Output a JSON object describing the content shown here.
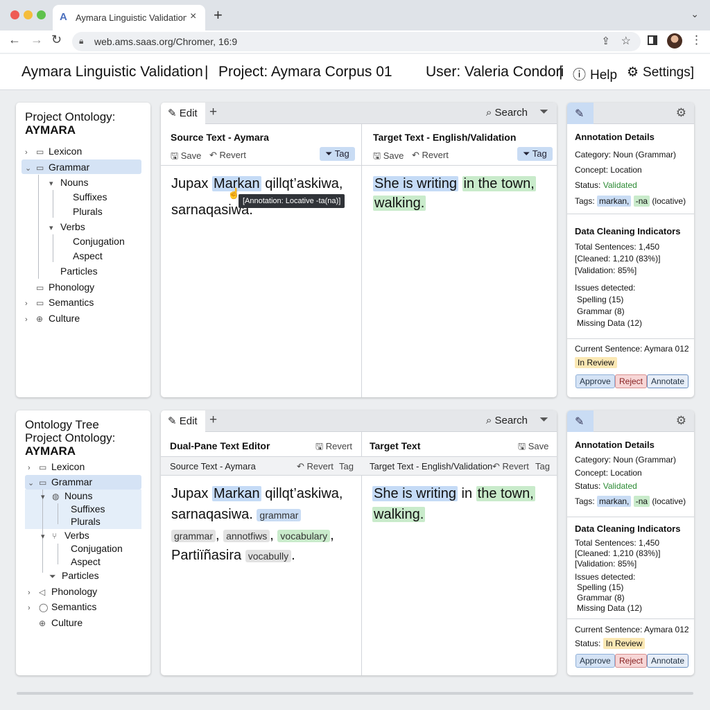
{
  "browser": {
    "tab_title": "Aymara Linguistic Validation",
    "url": "web.ams.saas.org/Chromer, 16:9"
  },
  "header": {
    "app_title": "Aymara Linguistic Validation",
    "separator": "|",
    "project": "Project: Aymara Corpus 01",
    "user": "User: Valeria Condori",
    "help": "Help",
    "settings": "Settings]"
  },
  "tree1": {
    "title_line1": "Project Ontology:",
    "title_line2": "AYMARA",
    "items": [
      "Lexicon",
      "Grammar",
      "Nouns",
      "Suffixes",
      "Plurals",
      "Verbs",
      "Conjugation",
      "Aspect",
      "Particles",
      "Phonology",
      "Semantics",
      "Culture"
    ]
  },
  "editor1": {
    "tab": "Edit",
    "search": "Search",
    "source_title": "Source Text - Aymara",
    "target_title": "Target Text - English/Validation",
    "save": "Save",
    "revert": "Revert",
    "tag": "Tag",
    "src_w1": "Jupax",
    "src_hl": "Markan",
    "src_w2": "qillqt’askiwa,",
    "src_line2": "sarnaqasiwa.",
    "tooltip": "[Annotation: Locative -ta(na)]",
    "tgt_hl1": "She is writing",
    "tgt_hl2": "in the town,",
    "tgt_line2": "walking."
  },
  "side1": {
    "heading": "Annotation Details",
    "category": "Category: Noun (Grammar)",
    "concept": "Concept: Location",
    "status_label": "Status:",
    "status_value": "Validated",
    "tags_label": "Tags:",
    "tag1": "markan,",
    "tag2": "-na",
    "tag_note": "(locative)",
    "dc_heading": "Data Cleaning Indicators",
    "total": "Total Sentences: 1,450",
    "cleaned": "[Cleaned: 1,210 (83%)]",
    "validation": "[Validation: 85%]",
    "issues": "Issues detected:",
    "spelling": "Spelling (15)",
    "grammar": "Grammar (8)",
    "missing": "Missing Data (12)",
    "current": "Current Sentence: Aymara 012",
    "status_badge": "In Review",
    "approve": "Approve",
    "reject": "Reject",
    "annotate": "Annotate"
  },
  "tree2": {
    "title_line1": "Ontology Tree",
    "title_line2": "Project Ontology:",
    "title_line3": "AYMARA",
    "items": [
      "Lexicon",
      "Grammar",
      "Nouns",
      "Suffixes",
      "Plurals",
      "Verbs",
      "Conjugation",
      "Aspect",
      "Particles",
      "Phonology",
      "Semantics",
      "Culture"
    ]
  },
  "editor2": {
    "tab": "Edit",
    "search": "Search",
    "title_left": "Dual-Pane Text Editor",
    "title_right": "Target Text",
    "revert": "Revert",
    "save": "Save",
    "source_sub": "Source Text - Aymara",
    "target_sub": "Target Text - English/Validation",
    "tag": "Tag",
    "src_w1": "Jupax",
    "src_hl": "Markan",
    "src_w2": "qillqt’askiwa,",
    "src_l2": "sarnaqasiwa.",
    "chip_grammar": "grammar",
    "chip_grammar2": "grammar",
    "chip_annot": "annotfiws",
    "chip_vocab": "vocabulary",
    "comma": ",",
    "src_l4": "Partiïñasira",
    "chip_vocab2": "vocabully",
    "period": ".",
    "tgt_hl1": "She is writing",
    "tgt_in": "in",
    "tgt_hl2": "the town,",
    "tgt_line2": "walking."
  },
  "side2": {
    "heading": "Annotation Details",
    "category": "Category: Noun (Grammar)",
    "concept": "Concept: Location",
    "status_label": "Status:",
    "status_value": "Validated",
    "tags_label": "Tags:",
    "tag1": "markan,",
    "tag2": "-na",
    "tag_note": "(locative)",
    "dc_heading": "Data Cleaning Indicators",
    "total": "Total Sentences: 1,450",
    "cleaned": "[Cleaned: 1,210 (83%)]",
    "validation": "[Validation: 85%]",
    "issues": "Issues detected:",
    "spelling": "Spelling (15)",
    "grammar": "Grammar (8)",
    "missing": "Missing Data (12)",
    "current": "Current Sentence: Aymara 012",
    "status_label2": "Status:",
    "status_badge": "In Review",
    "approve": "Approve",
    "reject": "Reject",
    "annotate": "Annotate"
  }
}
